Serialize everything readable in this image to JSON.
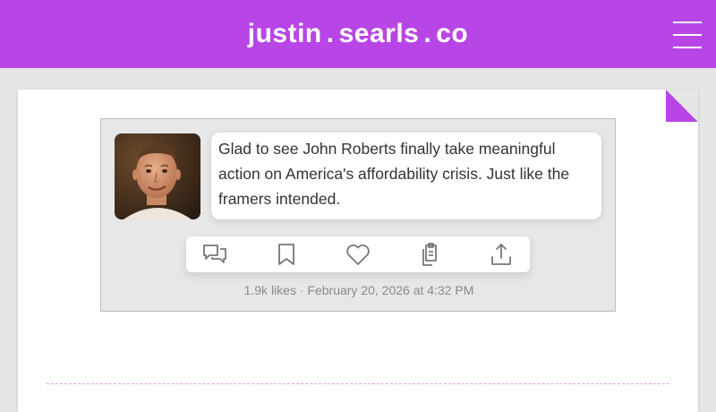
{
  "header": {
    "title_parts": [
      "justin",
      ".",
      "searls",
      ".",
      "co"
    ],
    "background": "#b846e6",
    "menu_icon": "hamburger-menu-icon"
  },
  "post": {
    "avatar_icon": "author-avatar",
    "text": "Glad to see John Roberts finally take meaningful action on America's affordability crisis. Just like the framers intended.",
    "likes": "1.9k likes",
    "separator": "·",
    "timestamp": "February 20, 2026 at 4:32 PM",
    "actions": [
      {
        "name": "reply",
        "icon": "reply-icon"
      },
      {
        "name": "bookmark",
        "icon": "bookmark-icon"
      },
      {
        "name": "like",
        "icon": "heart-icon"
      },
      {
        "name": "copy",
        "icon": "copy-icon"
      },
      {
        "name": "share",
        "icon": "share-icon"
      }
    ]
  },
  "colors": {
    "accent": "#b846e6",
    "page_background": "#e6e6e6",
    "divider": "#e59ee9"
  }
}
